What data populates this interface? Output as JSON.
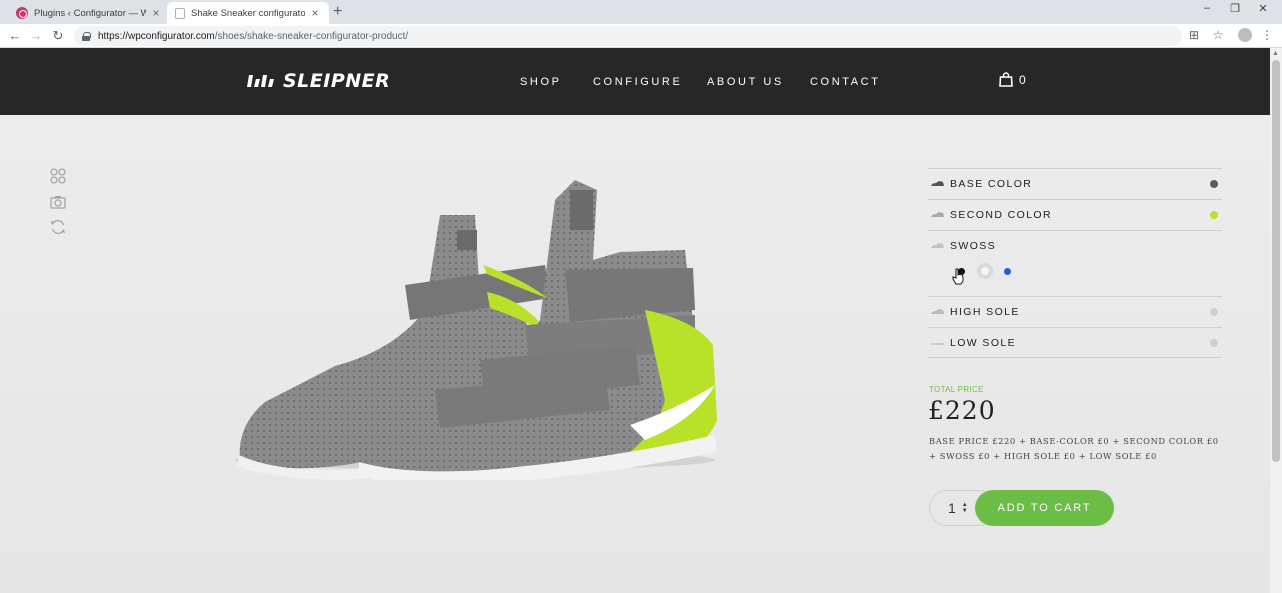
{
  "browser": {
    "tabs": [
      {
        "title": "Plugins ‹ Configurator — WordPress"
      },
      {
        "title": "Shake Sneaker configurator Product"
      }
    ],
    "url_host": "https://wpconfigurator.com",
    "url_path": "/shoes/shake-sneaker-configurator-product/"
  },
  "site": {
    "brand": "SLEIPNER",
    "nav": [
      "SHOP",
      "CONFIGURE",
      "ABOUT US",
      "CONTACT"
    ],
    "cart_count": "0"
  },
  "tools": [
    "grid-icon",
    "camera-icon",
    "rotate-icon"
  ],
  "options": [
    {
      "label": "BASE COLOR",
      "color": "#5d5d5d"
    },
    {
      "label": "SECOND COLOR",
      "color": "#b8e22a"
    },
    {
      "label": "SWOSS",
      "swatches": [
        "#111111",
        "#f4f4f4",
        "#1c5fe0"
      ],
      "selected": 1
    },
    {
      "label": "HIGH SOLE",
      "color": "#cfcfcf"
    },
    {
      "label": "LOW SOLE",
      "color": "#cfcfcf"
    }
  ],
  "pricing": {
    "label": "TOTAL PRICE",
    "total": "£220",
    "breakdown": "BASE PRICE £220 + BASE-COLOR £0 + SECOND COLOR £0 + SWOSS £0 + HIGH SOLE £0 + LOW SOLE £0"
  },
  "purchase": {
    "quantity": "1",
    "add_to_cart": "ADD TO CART"
  },
  "colors": {
    "accent": "#6cbd45",
    "header": "#272727",
    "shoe_base": "#8a8a8a",
    "shoe_accent": "#b8e22a"
  }
}
